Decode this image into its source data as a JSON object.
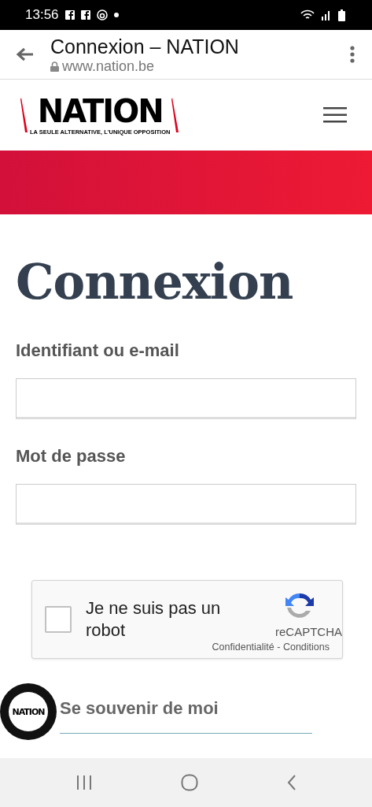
{
  "status_bar": {
    "time": "13:56"
  },
  "browser": {
    "title": "Connexion – NATION",
    "url": "www.nation.be"
  },
  "site_header": {
    "logo": "NATION",
    "tagline": "LA SEULE ALTERNATIVE, L'UNIQUE OPPOSITION"
  },
  "login": {
    "heading": "Connexion",
    "fields": [
      {
        "label": "Identifiant ou e-mail"
      },
      {
        "label": "Mot de passe"
      }
    ],
    "captcha": {
      "label": "Je ne suis pas un robot",
      "checked": false,
      "brand": "reCAPTCHA",
      "privacy": "Confidentialité",
      "separator": "-",
      "terms": "Conditions"
    },
    "remember": {
      "label": "Se souvenir de moi"
    }
  },
  "floating_badge": {
    "text": "NATION"
  }
}
